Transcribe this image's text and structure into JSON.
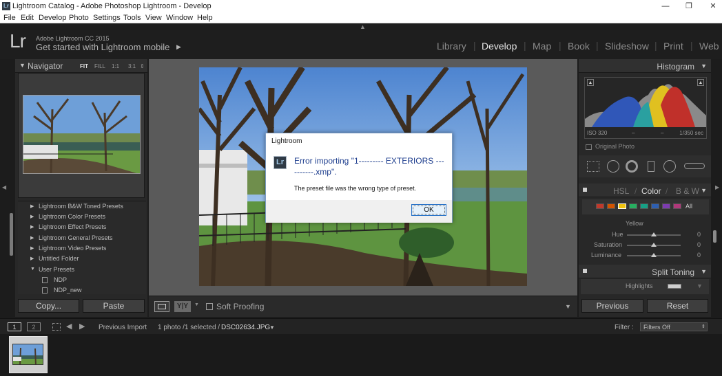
{
  "window": {
    "title": "Lightroom Catalog - Adobe Photoshop Lightroom - Develop",
    "app_badge": "Lr",
    "minimize": "—",
    "maximize": "❐",
    "close": "✕"
  },
  "menu": [
    "File",
    "Edit",
    "Develop",
    "Photo",
    "Settings",
    "Tools",
    "View",
    "Window",
    "Help"
  ],
  "identity": {
    "logo": "Lr",
    "version": "Adobe Lightroom CC 2015",
    "mobile": "Get started with Lightroom mobile",
    "mobile_arrow": "▶"
  },
  "modules": [
    {
      "label": "Library",
      "active": false
    },
    {
      "label": "Develop",
      "active": true
    },
    {
      "label": "Map",
      "active": false
    },
    {
      "label": "Book",
      "active": false
    },
    {
      "label": "Slideshow",
      "active": false
    },
    {
      "label": "Print",
      "active": false
    },
    {
      "label": "Web",
      "active": false
    }
  ],
  "navigator": {
    "title": "Navigator",
    "zoom": [
      "FIT",
      "FILL",
      "1:1",
      "3:1"
    ],
    "zoom_arrows": "⇕"
  },
  "presets": [
    {
      "label": "Lightroom B&W Toned Presets",
      "expanded": false
    },
    {
      "label": "Lightroom Color Presets",
      "expanded": false
    },
    {
      "label": "Lightroom Effect Presets",
      "expanded": false
    },
    {
      "label": "Lightroom General Presets",
      "expanded": false
    },
    {
      "label": "Lightroom Video Presets",
      "expanded": false
    },
    {
      "label": "Untitled Folder",
      "expanded": false
    },
    {
      "label": "User Presets",
      "expanded": true
    },
    {
      "label": "NDP",
      "child": true
    },
    {
      "label": "NDP_new",
      "child": true
    }
  ],
  "left_buttons": {
    "copy": "Copy...",
    "paste": "Paste"
  },
  "dialog": {
    "title": "Lightroom",
    "icon": "Lr",
    "message": "Error importing \"1--------- EXTERIORS ----------.xmp\".",
    "detail": "The preset file was the wrong type of preset.",
    "ok": "OK"
  },
  "toolbar": {
    "yy": "Y|Y",
    "soft_proofing": "Soft Proofing",
    "dropdown": "▼"
  },
  "histogram": {
    "title": "Histogram",
    "iso": "ISO 320",
    "dash1": "–",
    "dash2": "–",
    "shutter": "1/350 sec",
    "original_photo": "Original Photo"
  },
  "hsl": {
    "tabs": [
      "HSL",
      "Color",
      "B & W"
    ],
    "active_tab": "Color",
    "all": "All",
    "swatches": [
      "#c0392b",
      "#d35400",
      "#f1c40f",
      "#27ae60",
      "#16a085",
      "#2e5fb0",
      "#7d3cb0",
      "#b0397a"
    ],
    "selected_color": "Yellow",
    "sliders": [
      {
        "label": "Hue",
        "value": "0"
      },
      {
        "label": "Saturation",
        "value": "0"
      },
      {
        "label": "Luminance",
        "value": "0"
      }
    ]
  },
  "split_toning": {
    "title": "Split Toning",
    "highlights": "Highlights"
  },
  "right_buttons": {
    "previous": "Previous",
    "reset": "Reset"
  },
  "filmstrip": {
    "screen1": "1",
    "screen2": "2",
    "source": "Previous Import",
    "count": "1 photo /1 selected /",
    "filename": "DSC02634.JPG",
    "filename_arrow": "▼",
    "filter_label": "Filter :",
    "filter_value": "Filters Off"
  }
}
